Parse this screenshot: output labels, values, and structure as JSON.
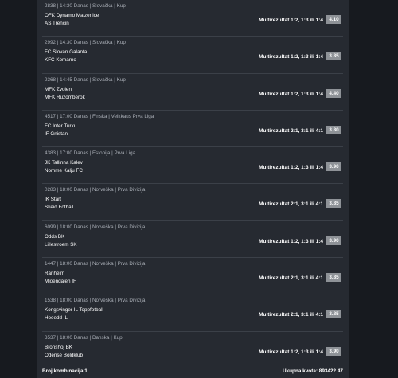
{
  "matches": [
    {
      "meta": "2838 | 14:30 Danas | Slovačka | Kup",
      "home": "OFK Dynamo Malzenice",
      "away": "AS Trencin",
      "bet": "Multirezultat 1:2, 1:3 ili 1:4",
      "odd": "4.10"
    },
    {
      "meta": "2992 | 14:30 Danas | Slovačka | Kup",
      "home": "FC Slovan Galanta",
      "away": "KFC Komarno",
      "bet": "Multirezultat 1:2, 1:3 ili 1:4",
      "odd": "3.85"
    },
    {
      "meta": "2368 | 14:45 Danas | Slovačka | Kup",
      "home": "MFK Zvolen",
      "away": "MFK Ruzomberok",
      "bet": "Multirezultat 1:2, 1:3 ili 1:4",
      "odd": "4.40"
    },
    {
      "meta": "4517 | 17:00 Danas | Finska | Veikkaus Prva Liga",
      "home": "FC Inter Turku",
      "away": "IF Gnistan",
      "bet": "Multirezultat 2:1, 3:1 ili 4:1",
      "odd": "3.80"
    },
    {
      "meta": "4383 | 17:00 Danas | Estonija | Prva Liga",
      "home": "JK Tallinna Kalev",
      "away": "Nomme Kalju FC",
      "bet": "Multirezultat 1:2, 1:3 ili 1:4",
      "odd": "3.90"
    },
    {
      "meta": "0283 | 18:00 Danas | Norveška | Prva Divizija",
      "home": "IK Start",
      "away": "Skeid Fotball",
      "bet": "Multirezultat 2:1, 3:1 ili 4:1",
      "odd": "3.85"
    },
    {
      "meta": "6099 | 18:00 Danas | Norveška | Prva Divizija",
      "home": "Odds BK",
      "away": "Lillestroem SK",
      "bet": "Multirezultat 1:2, 1:3 ili 1:4",
      "odd": "3.90"
    },
    {
      "meta": "1447 | 18:00 Danas | Norveška | Prva Divizija",
      "home": "Ranheim",
      "away": "Mjoendalen IF",
      "bet": "Multirezultat 2:1, 3:1 ili 4:1",
      "odd": "3.85"
    },
    {
      "meta": "1538 | 18:00 Danas | Norveška | Prva Divizija",
      "home": "Kongsvinger IL Toppfotball",
      "away": "Hoeedd IL",
      "bet": "Multirezultat 2:1, 3:1 ili 4:1",
      "odd": "3.85"
    },
    {
      "meta": "3537 | 18:00 Danas | Danska | Kup",
      "home": "Bronshoj BK",
      "away": "Odense Boldklub",
      "bet": "Multirezultat 1:2, 1:3 ili 1:4",
      "odd": "3.90"
    }
  ],
  "footer": {
    "combinations": "Broj kombinacija 1",
    "total_odds": "Ukupna kvota: 893422.47"
  },
  "colors": {
    "background": "#171a1f",
    "panel": "#262a31",
    "divider": "#3b4048",
    "odd_badge": "#8e9297",
    "meta_text": "#a9aeb6"
  }
}
